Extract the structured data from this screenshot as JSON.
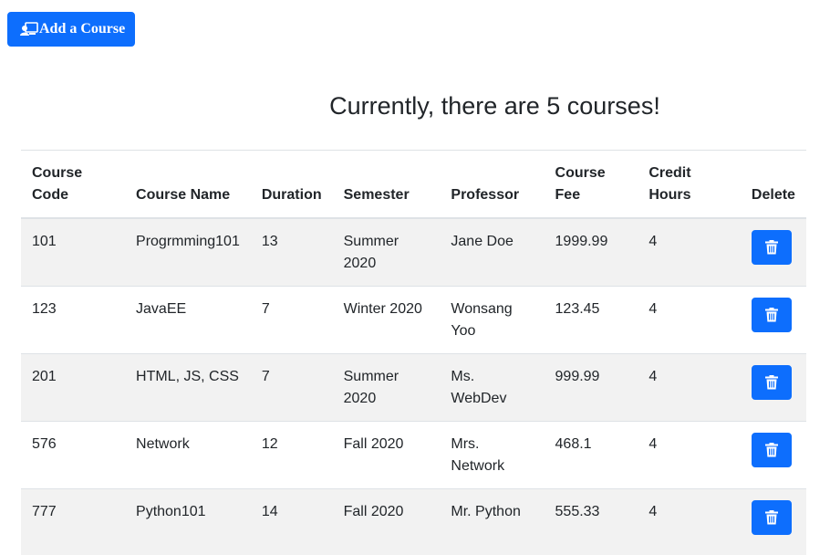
{
  "toolbar": {
    "add_course_label": "Add a Course",
    "add_course_icon": "person-video-icon"
  },
  "heading": "Currently, there are 5 courses!",
  "table": {
    "headers": [
      "Course Code",
      "Course Name",
      "Duration",
      "Semester",
      "Professor",
      "Course Fee",
      "Credit Hours",
      "Delete"
    ],
    "rows": [
      {
        "code": "101",
        "name": "Progrmming101",
        "duration": "13",
        "semester": "Summer 2020",
        "professor": "Jane Doe",
        "fee": "1999.99",
        "credit": "4"
      },
      {
        "code": "123",
        "name": "JavaEE",
        "duration": "7",
        "semester": "Winter 2020",
        "professor": "Wonsang Yoo",
        "fee": "123.45",
        "credit": "4"
      },
      {
        "code": "201",
        "name": "HTML, JS, CSS",
        "duration": "7",
        "semester": "Summer 2020",
        "professor": "Ms. WebDev",
        "fee": "999.99",
        "credit": "4"
      },
      {
        "code": "576",
        "name": "Network",
        "duration": "12",
        "semester": "Fall 2020",
        "professor": "Mrs. Network",
        "fee": "468.1",
        "credit": "4"
      },
      {
        "code": "777",
        "name": "Python101",
        "duration": "14",
        "semester": "Fall 2020",
        "professor": "Mr. Python",
        "fee": "555.33",
        "credit": "4"
      }
    ],
    "delete_icon": "trash-icon"
  },
  "colors": {
    "primary": "#0d6efd",
    "striped_row": "#f2f2f2",
    "border": "#dee2e6",
    "text": "#212529"
  }
}
